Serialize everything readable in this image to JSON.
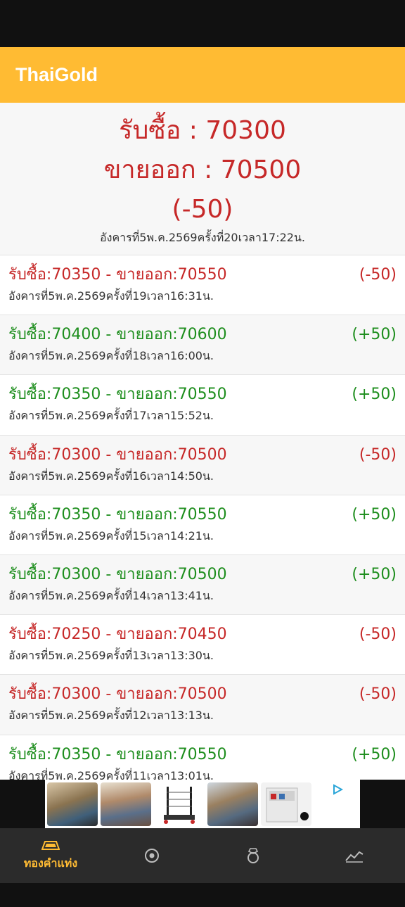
{
  "app": {
    "title": "ThaiGold"
  },
  "current": {
    "buy": "รับซื้อ : 70300",
    "sell": "ขายออก : 70500",
    "change": "(-50)",
    "timestamp": "อังคารที่5พ.ค.2569ครั้งที่20เวลา17:22น."
  },
  "history": [
    {
      "main": "รับซื้อ:70350 - ขายออก:70550",
      "change": "(-50)",
      "direction": "down",
      "time": "อังคารที่5พ.ค.2569ครั้งที่19เวลา16:31น."
    },
    {
      "main": "รับซื้อ:70400 - ขายออก:70600",
      "change": "(+50)",
      "direction": "up",
      "time": "อังคารที่5พ.ค.2569ครั้งที่18เวลา16:00น."
    },
    {
      "main": "รับซื้อ:70350 - ขายออก:70550",
      "change": "(+50)",
      "direction": "up",
      "time": "อังคารที่5พ.ค.2569ครั้งที่17เวลา15:52น."
    },
    {
      "main": "รับซื้อ:70300 - ขายออก:70500",
      "change": "(-50)",
      "direction": "down",
      "time": "อังคารที่5พ.ค.2569ครั้งที่16เวลา14:50น."
    },
    {
      "main": "รับซื้อ:70350 - ขายออก:70550",
      "change": "(+50)",
      "direction": "up",
      "time": "อังคารที่5พ.ค.2569ครั้งที่15เวลา14:21น."
    },
    {
      "main": "รับซื้อ:70300 - ขายออก:70500",
      "change": "(+50)",
      "direction": "up",
      "time": "อังคารที่5พ.ค.2569ครั้งที่14เวลา13:41น."
    },
    {
      "main": "รับซื้อ:70250 - ขายออก:70450",
      "change": "(-50)",
      "direction": "down",
      "time": "อังคารที่5พ.ค.2569ครั้งที่13เวลา13:30น."
    },
    {
      "main": "รับซื้อ:70300 - ขายออก:70500",
      "change": "(-50)",
      "direction": "down",
      "time": "อังคารที่5พ.ค.2569ครั้งที่12เวลา13:13น."
    },
    {
      "main": "รับซื้อ:70350 - ขายออก:70550",
      "change": "(+50)",
      "direction": "up",
      "time": "อังคารที่5พ.ค.2569ครั้งที่11เวลา13:01น."
    }
  ],
  "nav": {
    "items": [
      {
        "label": "ทองคำแท่ง",
        "icon": "gold-bar-icon",
        "active": true
      },
      {
        "label": "",
        "icon": "target-icon",
        "active": false
      },
      {
        "label": "",
        "icon": "ring-icon",
        "active": false
      },
      {
        "label": "",
        "icon": "chart-icon",
        "active": false
      }
    ]
  },
  "colors": {
    "accent": "#FFBB33",
    "up": "#1e8e1e",
    "down": "#c62828",
    "nav_bg": "#2b2b2b"
  },
  "ad": {
    "icon": "adchoices-play-icon"
  }
}
